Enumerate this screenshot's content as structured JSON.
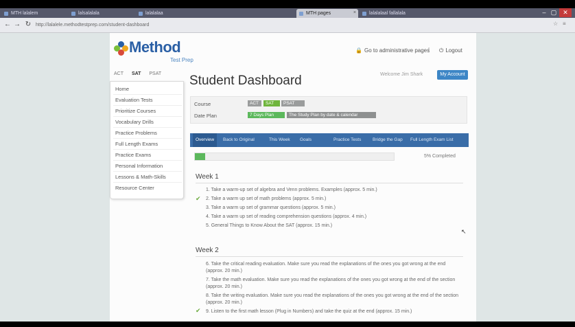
{
  "browser": {
    "tabs": [
      {
        "label": "MTH lalalem",
        "active": false
      },
      {
        "label": "lalsalalala",
        "active": false
      },
      {
        "label": "lalalalaa",
        "active": false
      },
      {
        "label": "MTH pages",
        "active": true
      },
      {
        "label": "lalalalaal fallalala",
        "active": false
      }
    ],
    "url": "http://lalalele.methodtestprep.com/student-dashboard",
    "window_controls": [
      "–",
      "▢",
      "✕"
    ]
  },
  "header": {
    "logo_word": "Method",
    "logo_sub": "Test Prep",
    "admin_link": "Go to administrative pages",
    "separator": "|",
    "logout_link": "Logout"
  },
  "test_tabs": [
    "ACT",
    "SAT",
    "PSAT"
  ],
  "sidebar": {
    "items": [
      "Home",
      "Evaluation Tests",
      "Prioritize Courses",
      "Vocabulary Drills",
      "Practice Problems",
      "Full Length Exams",
      "Practice Exams",
      "Personal Information",
      "Lessons & Math-Skills",
      "Resource Center"
    ]
  },
  "main": {
    "title": "Student Dashboard",
    "welcome": "Welcome Jim Shark",
    "my_account": "My Account",
    "course_label": "Course",
    "course_chips": [
      "ACT",
      "SAT",
      "PSAT"
    ],
    "date_label": "Date Plan",
    "date_chips": [
      "7 Days Plan",
      "The Study Plan by date & calendar"
    ],
    "nav_tabs": [
      "Overview",
      "Back to Original",
      "This Week",
      "Goals",
      "Practice Tests",
      "Bridge the Gap",
      "Full Length Exam List"
    ],
    "progress": 0.05,
    "progress_text": "5% Completed",
    "weeks": [
      {
        "title": "Week 1",
        "tasks": [
          {
            "text": "1. Take a warm-up set of algebra and Venn problems. Examples (approx. 5 min.)",
            "done": false
          },
          {
            "text": "2. Take a warm up set of math problems (approx. 5 min.)",
            "done": true
          },
          {
            "text": "3. Take a warm up set of grammar questions (approx. 5 min.)",
            "done": false
          },
          {
            "text": "4. Take a warm up set of reading comprehension questions (approx. 4 min.)",
            "done": false
          },
          {
            "text": "5. General Things to Know About the SAT (approx. 15 min.)",
            "done": false
          }
        ]
      },
      {
        "title": "Week 2",
        "tasks": [
          {
            "text": "6. Take the critical reading evaluation. Make sure you read the explanations of the ones you got wrong at the end (approx. 20 min.)",
            "done": false
          },
          {
            "text": "7. Take the math evaluation. Make sure you read the explanations of the ones you got wrong at the end of the section (approx. 20 min.)",
            "done": false
          },
          {
            "text": "8. Take the writing evaluation. Make sure you read the explanations of the ones you got wrong at the end of the section (approx. 20 min.)",
            "done": false
          },
          {
            "text": "9. Listen to the first math lesson (Plug in Numbers) and take the quiz at the end (approx. 15 min.)",
            "done": true
          }
        ]
      }
    ]
  },
  "colors": {
    "brand_blue": "#2a5fa5",
    "nav_blue": "#3a6da8",
    "green": "#5cb85c",
    "chip_gray": "#8e9090"
  }
}
